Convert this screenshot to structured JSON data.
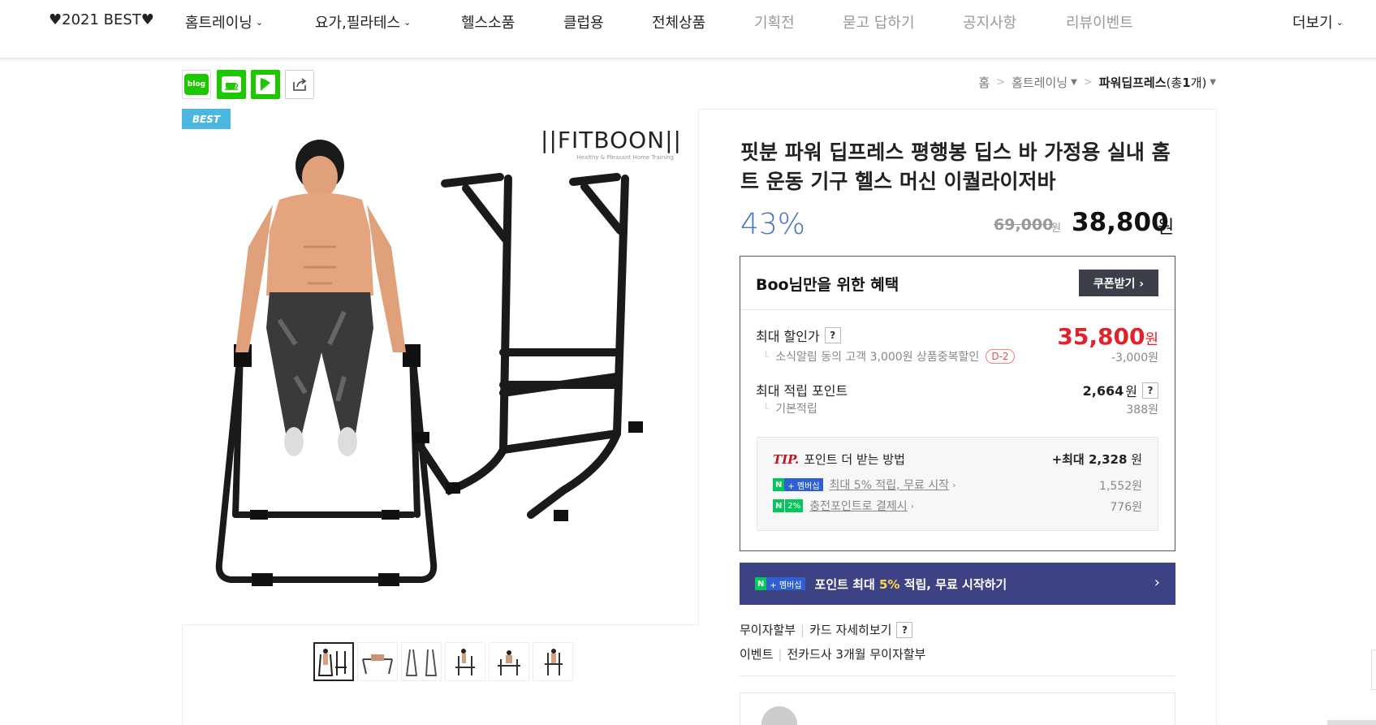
{
  "nav": {
    "items": [
      {
        "label": "♥2021 BEST♥",
        "caret": false,
        "dim": false
      },
      {
        "label": "홈트레이닝",
        "caret": true,
        "dim": false
      },
      {
        "label": "요가,필라테스",
        "caret": true,
        "dim": false
      },
      {
        "label": "헬스소품",
        "caret": false,
        "dim": false
      },
      {
        "label": "클럽용",
        "caret": false,
        "dim": false
      },
      {
        "label": "전체상품",
        "caret": false,
        "dim": false
      },
      {
        "label": "기획전",
        "caret": false,
        "dim": true
      },
      {
        "label": "묻고 답하기",
        "caret": false,
        "dim": true
      },
      {
        "label": "공지사항",
        "caret": false,
        "dim": true
      },
      {
        "label": "리뷰이벤트",
        "caret": false,
        "dim": true
      }
    ],
    "more_label": "더보기"
  },
  "share": {
    "blog_label": "blog"
  },
  "breadcrumb": {
    "home": "홈",
    "category": "홈트레이닝",
    "current": "파워딥프레스",
    "count_prefix": "(총 ",
    "count": "1",
    "count_suffix": "개)"
  },
  "product": {
    "badge": "BEST",
    "brand_logo": "||FITBOON||",
    "brand_tagline": "Healthy & Pleasant Home Training",
    "title": "핏분 파워 딥프레스 평행봉 딥스 바 가정용 실내 홈트 운동 기구 헬스 머신 이퀄라이저바",
    "discount": "43%",
    "original_price": "69,000",
    "original_unit": "원",
    "sale_price": "38,800",
    "sale_unit": "원"
  },
  "benefit": {
    "title": "Boo님만을 위한 혜택",
    "coupon_button": "쿠폰받기 ›",
    "max_discount_label": "최대 할인가",
    "max_discount_price": "35,800",
    "price_unit": "원",
    "news_discount_text": "소식알림 동의 고객 3,000원 상품중복할인",
    "d_day": "D-2",
    "news_discount_amount": "-3,000원",
    "max_points_label": "최대 적립 포인트",
    "max_points": "2,664",
    "base_points_label": "기본적립",
    "base_points": "388원",
    "help": "?"
  },
  "tip": {
    "tip_word": "TIP.",
    "title": "포인트 더 받는 방법",
    "max_prefix": "+최대 ",
    "max_amount": "2,328",
    "max_unit": " 원",
    "row1_badge_n": "N",
    "row1_badge_plus": "+ 멤버십",
    "row1_text": "최대 5% 적립, 무료 시작",
    "row1_amount": "1,552원",
    "row2_badge_n": "N",
    "row2_badge_pct": "2%",
    "row2_text": "충전포인트로 결제시",
    "row2_amount": "776원"
  },
  "npay_banner": {
    "badge_n": "N",
    "badge_plus": "+ 멤버십",
    "text_prefix": "포인트 최대 ",
    "text_highlight": "5%",
    "text_suffix": " 적립, 무료 시작하기",
    "arrow": "›"
  },
  "info": {
    "installment_label": "무이자할부",
    "card_detail_label": "카드 자세히보기",
    "event_label": "이벤트",
    "event_text": "전카드사 3개월 무이자할부"
  },
  "colors": {
    "accent_discount": "#4a72c4",
    "price_red": "#e0232b",
    "npay_green": "#03c75a",
    "npay_banner": "#3d4284",
    "best_badge": "#4bb6e0"
  }
}
